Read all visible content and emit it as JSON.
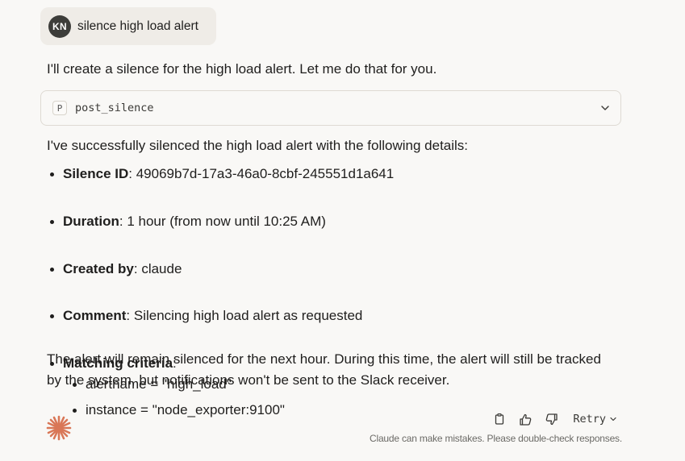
{
  "user_message": {
    "avatar_initials": "KN",
    "text": "silence high load alert"
  },
  "assistant": {
    "intro": "I'll create a silence for the high load alert. Let me do that for you.",
    "tool_call": {
      "badge": "P",
      "name": "post_silence",
      "icon": "chevron-down-icon"
    },
    "success_text": "I've successfully silenced the high load alert with the following details:",
    "details": [
      {
        "label": "Silence ID",
        "value": ": 49069b7d-17a3-46a0-8cbf-245551d1a641"
      },
      {
        "label": "Duration",
        "value": ": 1 hour (from now until 10:25 AM)"
      },
      {
        "label": "Created by",
        "value": ": claude"
      },
      {
        "label": "Comment",
        "value": ": Silencing high load alert as requested"
      },
      {
        "label": "Matching criteria",
        "value": ":"
      }
    ],
    "matching_criteria": [
      "alertname = \"high_load\"",
      "instance = \"node_exporter:9100\""
    ],
    "closing_line_1": "The alert will remain silenced for the next hour. During this time, the alert will still be tracked",
    "closing_line_2": "by the system, but notifications won't be sent to the Slack receiver."
  },
  "footer": {
    "logo_icon": "claude-spark-icon",
    "copy_icon": "copy-icon",
    "thumbs_up_icon": "thumbs-up-icon",
    "thumbs_down_icon": "thumbs-down-icon",
    "retry_label": "Retry",
    "disclaimer": "Claude can make mistakes. Please double-check responses."
  },
  "colors": {
    "background": "#f9f8f6",
    "user_bubble": "#efece7",
    "avatar": "#3d3d3a",
    "brand_spark": "#d97757",
    "text": "#1f1e1d"
  }
}
